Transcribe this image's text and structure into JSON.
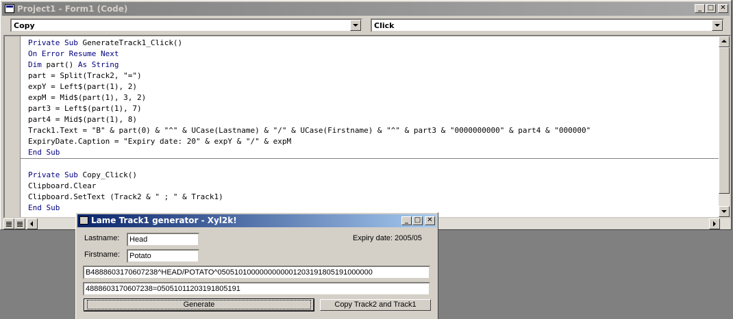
{
  "code_window": {
    "title": "Project1 - Form1 (Code)",
    "object_combo": "Copy",
    "procedure_combo": "Click",
    "code_lines": [
      "Private Sub GenerateTrack1_Click()",
      "On Error Resume Next",
      "Dim part() As String",
      "part = Split(Track2, \"=\")",
      "expY = Left$(part(1), 2)",
      "expM = Mid$(part(1), 3, 2)",
      "part3 = Left$(part(1), 7)",
      "part4 = Mid$(part(1), 8)",
      "Track1.Text = \"B\" & part(0) & \"^\" & UCase(Lastname) & \"/\" & UCase(Firstname) & \"^\" & part3 & \"0000000000\" & part4 & \"000000\"",
      "ExpiryDate.Caption = \"Expiry date: 20\" & expY & \"/\" & expM",
      "End Sub",
      "",
      "Private Sub Copy_Click()",
      "Clipboard.Clear",
      "Clipboard.SetText (Track2 & \" ; \" & Track1)",
      "End Sub"
    ]
  },
  "dialog": {
    "title": "Lame Track1 generator - Xyl2k!",
    "lastname_label": "Lastname:",
    "lastname_value": "Head",
    "firstname_label": "Firstname:",
    "firstname_value": "Potato",
    "expiry_label": "Expiry date: 2005/05",
    "track1_value": "B4888603170607238^HEAD/POTATO^0505101000000000001203191805191000000",
    "track2_value": "4888603170607238=0505101120319180519​1",
    "generate_label": "Generate",
    "copy_label": "Copy Track2 and Track1"
  },
  "colors": {
    "inactive_title": "#808080",
    "active_title": "#0a246a",
    "keyword": "#000080",
    "face": "#d4d0c8"
  },
  "icons": [
    "minimize-icon",
    "maximize-icon",
    "close-icon",
    "dropdown-arrow-icon",
    "scroll-up-icon",
    "scroll-down-icon"
  ]
}
